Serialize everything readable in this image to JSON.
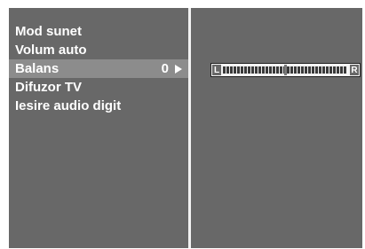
{
  "menu": {
    "items": [
      {
        "label": "Mod sunet",
        "value": null,
        "selected": false
      },
      {
        "label": "Volum auto",
        "value": null,
        "selected": false
      },
      {
        "label": "Balans",
        "value": "0",
        "selected": true
      },
      {
        "label": "Difuzor TV",
        "value": null,
        "selected": false
      },
      {
        "label": "Iesire audio digit",
        "value": null,
        "selected": false
      }
    ]
  },
  "balance_slider": {
    "left_label": "L",
    "right_label": "R",
    "value": 0,
    "range": [
      -50,
      50
    ]
  },
  "icons": {
    "selected_arrow": "arrow-right-icon"
  },
  "colors": {
    "panel": "#686868",
    "selected_row": "#8c8c8c",
    "text": "#ffffff",
    "divider": "#f2f2f2"
  }
}
